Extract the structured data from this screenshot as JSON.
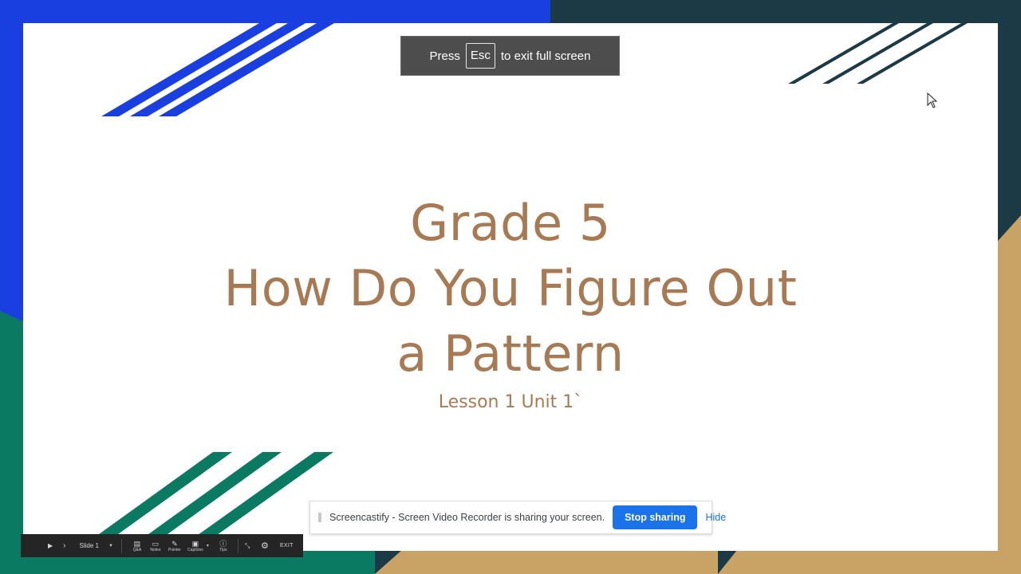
{
  "slide": {
    "title_lines": [
      "Grade 5",
      "How Do You Figure Out",
      "a Pattern"
    ],
    "subtitle": "Lesson 1 Unit 1`"
  },
  "fullscreen_notice": {
    "before": "Press",
    "key": "Esc",
    "after": "to exit full screen"
  },
  "screen_share": {
    "message": "Screencastify - Screen Video Recorder is sharing your screen.",
    "stop_label": "Stop sharing",
    "hide_label": "Hide"
  },
  "presenter_toolbar": {
    "slide_label": "Slide 1",
    "qa_label": "Q&A",
    "notes_label": "Notes",
    "pointer_label": "Pointer",
    "captions_label": "Captions",
    "tips_label": "Tips",
    "exit_label": "EXIT"
  },
  "colors": {
    "title": "#a87a54",
    "blue": "#1a3fe0",
    "teal": "#0a7a63",
    "gold": "#c9a265",
    "dark": "#1b3a45",
    "button_blue": "#1a73e8"
  },
  "icons": {
    "cursor": "mouse-pointer-icon",
    "play": "play-icon",
    "next": "chevron-right-icon",
    "qa": "qa-icon",
    "notes": "notes-icon",
    "pointer": "laser-pointer-icon",
    "captions": "captions-icon",
    "tips": "info-icon",
    "fullscreen": "exit-fullscreen-icon",
    "settings": "gear-icon"
  }
}
